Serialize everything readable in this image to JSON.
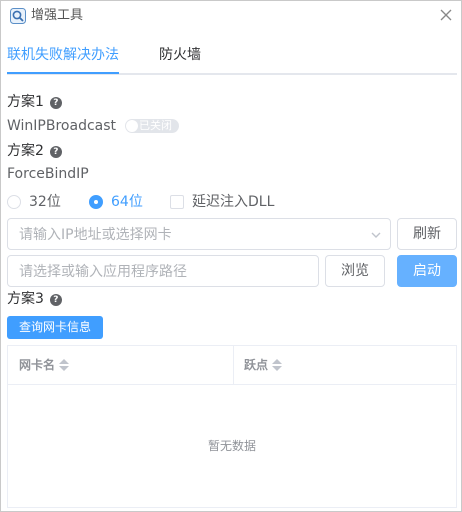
{
  "window": {
    "title": "增强工具"
  },
  "tabs": [
    {
      "label": "联机失败解决办法",
      "active": true
    },
    {
      "label": "防火墙",
      "active": false
    }
  ],
  "plan1": {
    "label": "方案1",
    "help": "?",
    "name": "WinIPBroadcast",
    "switch_text": "已关闭",
    "enabled": false
  },
  "plan2": {
    "label": "方案2",
    "help": "?",
    "name": "ForceBindIP",
    "radio_32": "32位",
    "radio_64": "64位",
    "selected": "64位",
    "checkbox_label": "延迟注入DLL",
    "checkbox_checked": false,
    "ip_placeholder": "请输入IP地址或选择网卡",
    "refresh_label": "刷新",
    "path_placeholder": "请选择或输入应用程序路径",
    "browse_label": "浏览",
    "start_label": "启动"
  },
  "plan3": {
    "label": "方案3",
    "help": "?",
    "query_label": "查询网卡信息"
  },
  "table": {
    "columns": [
      "网卡名",
      "跃点"
    ],
    "empty_text": "暂无数据"
  },
  "colors": {
    "accent": "#409eff",
    "primary_button": "#66b1ff",
    "border": "#dcdfe6"
  }
}
